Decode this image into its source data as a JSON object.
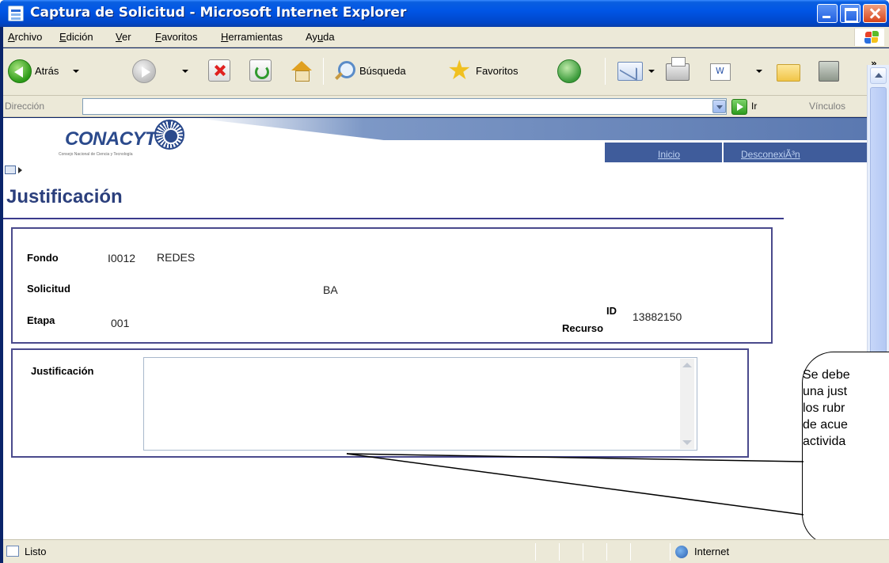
{
  "window": {
    "title": "Captura de Solicitud - Microsoft Internet Explorer"
  },
  "menu": {
    "items": [
      {
        "pre": "",
        "ul": "A",
        "post": "rchivo"
      },
      {
        "pre": "",
        "ul": "E",
        "post": "dición"
      },
      {
        "pre": "",
        "ul": "V",
        "post": "er"
      },
      {
        "pre": "",
        "ul": "F",
        "post": "avoritos"
      },
      {
        "pre": "",
        "ul": "H",
        "post": "erramientas"
      },
      {
        "pre": "Ay",
        "ul": "u",
        "post": "da"
      }
    ]
  },
  "toolbar": {
    "back_label": "Atrás",
    "search_label": "Búsqueda",
    "favorites_label": "Favoritos",
    "more": "»"
  },
  "address": {
    "label": "Dirección",
    "value": "",
    "go_label": "Ir",
    "links_label": "Vínculos",
    "more": "»"
  },
  "site": {
    "logo": "CONACYT",
    "logo_tagline": "Consejo Nacional de Ciencia y Tecnología",
    "nav": {
      "home": "Inicio",
      "logout": "DesconexiÃ³n"
    }
  },
  "page": {
    "title": "Justificación"
  },
  "info": {
    "fondo_label": "Fondo",
    "fondo_code": "I0012",
    "fondo_name": "REDES",
    "solicitud_label": "Solicitud",
    "solicitud_value": "BA",
    "etapa_label": "Etapa",
    "etapa_value": "001",
    "id_label": "ID",
    "recurso_label": "Recurso",
    "recurso_value": "13882150"
  },
  "justification": {
    "label": "Justificación",
    "value": ""
  },
  "callout": {
    "text": "Se debe\nuna just\nlos rubr\nde acue\nactivida"
  },
  "status": {
    "text": "Listo",
    "zone": "Internet"
  }
}
